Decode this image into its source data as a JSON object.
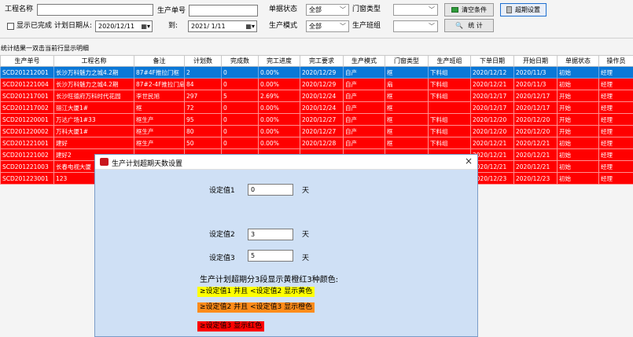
{
  "filters": {
    "project_name_label": "工程名称",
    "order_no_label": "生产单号",
    "doc_status_label": "单据状态",
    "doc_status_value": "全部",
    "window_type_label": "门窗类型",
    "window_type_value": "",
    "clear_button": "清空条件",
    "overdue_button": "超期设置",
    "show_done_label": "显示已完成",
    "plan_date_from_label": "计划日期从:",
    "date_from": "2020/12/11",
    "to_label": "到:",
    "date_to": "2021/ 1/11",
    "prod_mode_label": "生产模式",
    "prod_mode_value": "全部",
    "prod_team_label": "生产班组",
    "prod_team_value": "",
    "stats_button": "统 计"
  },
  "results_caption": "统计结果一双击当前行显示明细",
  "grid": {
    "headers": [
      "生产单号",
      "工程名称",
      "备注",
      "计划数",
      "完成数",
      "完工进度",
      "完工要求",
      "生产模式",
      "门窗类型",
      "生产班组",
      "下单日期",
      "开始日期",
      "单据状态",
      "操作员"
    ],
    "rows": [
      [
        "SCD201212001",
        "长沙万科魅力之城4.2期",
        "87#4F推拉门框",
        "2",
        "0",
        "0.00%",
        "2020/12/29",
        "自产",
        "框",
        "下料组",
        "2020/12/12",
        "2020/11/3",
        "初始",
        "经理"
      ],
      [
        "SCD201221004",
        "长沙万科魅力之城4.2期",
        "87#2-4F推拉门扇",
        "84",
        "0",
        "0.00%",
        "2020/12/29",
        "自产",
        "扇",
        "下料组",
        "2020/12/21",
        "2020/11/3",
        "初始",
        "经理"
      ],
      [
        "SCD201217001",
        "长沙旺德府万科时代花园",
        "李世民旭",
        "297",
        "5",
        "2.69%",
        "2020/12/24",
        "自产",
        "框",
        "下料组",
        "2020/12/17",
        "2020/12/17",
        "开始",
        "经理"
      ],
      [
        "SCD201217002",
        "丽江大厦1#",
        "框",
        "72",
        "0",
        "0.00%",
        "2020/12/24",
        "自产",
        "框",
        "",
        "2020/12/17",
        "2020/12/17",
        "开始",
        "经理"
      ],
      [
        "SCD201220001",
        "万达广场1#33",
        "框生产",
        "95",
        "0",
        "0.00%",
        "2020/12/27",
        "自产",
        "框",
        "下料组",
        "2020/12/20",
        "2020/12/20",
        "开始",
        "经理"
      ],
      [
        "SCD201220002",
        "万科大厦1#",
        "框生产",
        "80",
        "0",
        "0.00%",
        "2020/12/27",
        "自产",
        "框",
        "下料组",
        "2020/12/20",
        "2020/12/20",
        "开始",
        "经理"
      ],
      [
        "SCD201221001",
        "建好",
        "框生产",
        "50",
        "0",
        "0.00%",
        "2020/12/28",
        "自产",
        "框",
        "下料组",
        "2020/12/21",
        "2020/12/21",
        "初始",
        "经理"
      ],
      [
        "SCD201221002",
        "建好2",
        "",
        "",
        "",
        "",
        "",
        "",
        "",
        "",
        "2020/12/21",
        "2020/12/21",
        "初始",
        "经理"
      ],
      [
        "SCD201221003",
        "长春电视大厦",
        "",
        "",
        "",
        "",
        "",
        "",
        "",
        "",
        "2020/12/21",
        "2020/12/21",
        "初始",
        "经理"
      ],
      [
        "SCD201223001",
        "123",
        "",
        "",
        "",
        "",
        "",
        "",
        "",
        "",
        "2020/12/23",
        "2020/12/23",
        "初始",
        "经理"
      ]
    ]
  },
  "dialog": {
    "title": "生产计划超期天数设置",
    "close": "×",
    "v1_label": "设定值1",
    "v1": "0",
    "v2_label": "设定值2",
    "v2": "3",
    "v3_label": "设定值3",
    "v3": "5",
    "unit": "天",
    "desc": "生产计划超期分3段显示黄橙红3种颜色:",
    "rule_yellow": "≥设定值1 并且 <设定值2 显示黄色",
    "rule_orange": "≥设定值2 并且 <设定值3 显示橙色",
    "rule_red": "≥设定值3 显示红色"
  },
  "colors": {
    "row_red": "#ff0000",
    "row_selected": "#0a78d7",
    "yellow": "#ffff00",
    "orange": "#ff8c1a",
    "red": "#ff0000",
    "dialog_bg": "#cfe0f5"
  }
}
